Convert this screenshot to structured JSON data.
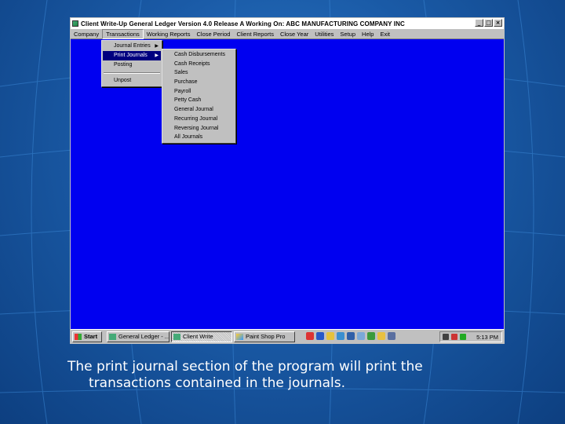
{
  "window": {
    "title": "Client Write-Up General Ledger   Version 4.0 Release A      Working On:  ABC MANUFACTURING COMPANY INC",
    "buttons": {
      "minimize": "_",
      "maximize": "□",
      "close": "×"
    }
  },
  "menu_bar": {
    "items": [
      {
        "label": "Company"
      },
      {
        "label": "Transactions"
      },
      {
        "label": "Working Reports"
      },
      {
        "label": "Close Period"
      },
      {
        "label": "Client Reports"
      },
      {
        "label": "Close Year"
      },
      {
        "label": "Utilities"
      },
      {
        "label": "Setup"
      },
      {
        "label": "Help"
      },
      {
        "label": "Exit"
      }
    ]
  },
  "transactions_menu": {
    "items": [
      {
        "label": "Journal Entries"
      },
      {
        "label": "Print Journals"
      },
      {
        "label": "Posting"
      },
      {
        "label": "Unpost"
      }
    ],
    "arrow": "▶"
  },
  "print_journals_submenu": {
    "items": [
      {
        "label": "Cash Disbursements"
      },
      {
        "label": "Cash Receipts"
      },
      {
        "label": "Sales"
      },
      {
        "label": "Purchase"
      },
      {
        "label": "Payroll"
      },
      {
        "label": "Petty Cash"
      },
      {
        "label": "General Journal"
      },
      {
        "label": "Recurring Journal"
      },
      {
        "label": "Reversing Journal"
      },
      {
        "label": "All Journals"
      }
    ]
  },
  "taskbar": {
    "start_label": "Start",
    "tasks": [
      {
        "label": "General Ledger - ..."
      },
      {
        "label": "Client Write"
      },
      {
        "label": "Paint Shop Pro"
      }
    ],
    "clock": "5:13 PM",
    "colors": {
      "face": "#c0c0c0",
      "active_task_bg": "#e0e0e0"
    }
  },
  "caption": {
    "line1": "The print journal section of the program will print the",
    "line2": "transactions contained in the journals."
  },
  "colors": {
    "desktop": "#0000f0",
    "highlight": "#000080",
    "slide_background": "#1a5aa6",
    "caption_text": "#ffffff"
  }
}
